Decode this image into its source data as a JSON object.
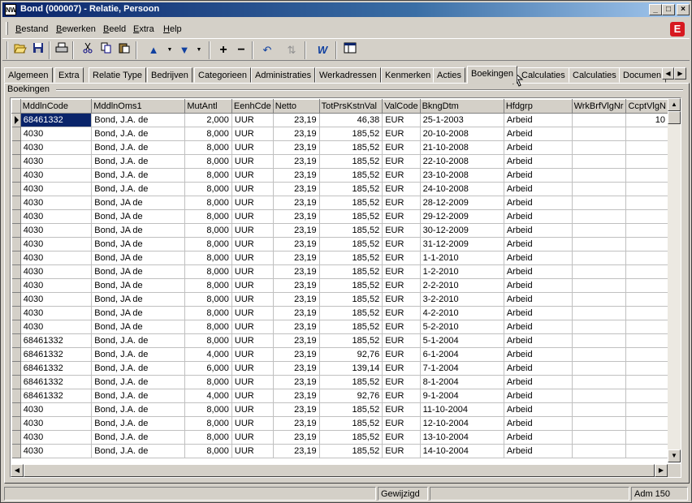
{
  "window": {
    "title": "Bond (000007) - Relatie, Persoon",
    "icon_label": "NW",
    "controls": [
      "_",
      "□",
      "×"
    ]
  },
  "menu": {
    "items": [
      "Bestand",
      "Bewerken",
      "Beeld",
      "Extra",
      "Help"
    ],
    "logo": "E"
  },
  "toolbar": {
    "icons": [
      "open-folder-icon",
      "save-icon",
      "print-icon",
      "cut-icon",
      "copy-icon",
      "paste-icon",
      "arrow-up-icon",
      "arrow-down-icon",
      "add-icon",
      "remove-icon",
      "undo-icon",
      "refresh-icon",
      "word-icon",
      "form-icon"
    ]
  },
  "tabs": {
    "items": [
      "Algemeen",
      "Extra",
      "Relatie Type",
      "Bedrijven",
      "Categorieen",
      "Administraties",
      "Werkadressen",
      "Kenmerken",
      "Acties",
      "Boekingen",
      "Calculaties",
      "Calculaties",
      "Documen"
    ],
    "active": "Boekingen"
  },
  "group": {
    "label": "Boekingen"
  },
  "grid": {
    "columns": [
      "MddlnCode",
      "MddlnOms1",
      "MutAntl",
      "EenhCde",
      "Netto",
      "TotPrsKstnVal",
      "ValCode",
      "BkngDtm",
      "Hfdgrp",
      "WrkBrfVlgNr",
      "CcptVlgN"
    ],
    "rows": [
      [
        "68461332",
        "Bond, J.A. de",
        "2,000",
        "UUR",
        "23,19",
        "46,38",
        "EUR",
        "25-1-2003",
        "Arbeid",
        "",
        "10"
      ],
      [
        "4030",
        "Bond, J.A. de",
        "8,000",
        "UUR",
        "23,19",
        "185,52",
        "EUR",
        "20-10-2008",
        "Arbeid",
        "",
        ""
      ],
      [
        "4030",
        "Bond, J.A. de",
        "8,000",
        "UUR",
        "23,19",
        "185,52",
        "EUR",
        "21-10-2008",
        "Arbeid",
        "",
        ""
      ],
      [
        "4030",
        "Bond, J.A. de",
        "8,000",
        "UUR",
        "23,19",
        "185,52",
        "EUR",
        "22-10-2008",
        "Arbeid",
        "",
        ""
      ],
      [
        "4030",
        "Bond, J.A. de",
        "8,000",
        "UUR",
        "23,19",
        "185,52",
        "EUR",
        "23-10-2008",
        "Arbeid",
        "",
        ""
      ],
      [
        "4030",
        "Bond, J.A. de",
        "8,000",
        "UUR",
        "23,19",
        "185,52",
        "EUR",
        "24-10-2008",
        "Arbeid",
        "",
        ""
      ],
      [
        "4030",
        "Bond, JA de",
        "8,000",
        "UUR",
        "23,19",
        "185,52",
        "EUR",
        "28-12-2009",
        "Arbeid",
        "",
        ""
      ],
      [
        "4030",
        "Bond, JA de",
        "8,000",
        "UUR",
        "23,19",
        "185,52",
        "EUR",
        "29-12-2009",
        "Arbeid",
        "",
        ""
      ],
      [
        "4030",
        "Bond, JA de",
        "8,000",
        "UUR",
        "23,19",
        "185,52",
        "EUR",
        "30-12-2009",
        "Arbeid",
        "",
        ""
      ],
      [
        "4030",
        "Bond, JA de",
        "8,000",
        "UUR",
        "23,19",
        "185,52",
        "EUR",
        "31-12-2009",
        "Arbeid",
        "",
        ""
      ],
      [
        "4030",
        "Bond, JA de",
        "8,000",
        "UUR",
        "23,19",
        "185,52",
        "EUR",
        "1-1-2010",
        "Arbeid",
        "",
        ""
      ],
      [
        "4030",
        "Bond, JA de",
        "8,000",
        "UUR",
        "23,19",
        "185,52",
        "EUR",
        "1-2-2010",
        "Arbeid",
        "",
        ""
      ],
      [
        "4030",
        "Bond, JA de",
        "8,000",
        "UUR",
        "23,19",
        "185,52",
        "EUR",
        "2-2-2010",
        "Arbeid",
        "",
        ""
      ],
      [
        "4030",
        "Bond, JA de",
        "8,000",
        "UUR",
        "23,19",
        "185,52",
        "EUR",
        "3-2-2010",
        "Arbeid",
        "",
        ""
      ],
      [
        "4030",
        "Bond, JA de",
        "8,000",
        "UUR",
        "23,19",
        "185,52",
        "EUR",
        "4-2-2010",
        "Arbeid",
        "",
        ""
      ],
      [
        "4030",
        "Bond, JA de",
        "8,000",
        "UUR",
        "23,19",
        "185,52",
        "EUR",
        "5-2-2010",
        "Arbeid",
        "",
        ""
      ],
      [
        "68461332",
        "Bond, J.A. de",
        "8,000",
        "UUR",
        "23,19",
        "185,52",
        "EUR",
        "5-1-2004",
        "Arbeid",
        "",
        ""
      ],
      [
        "68461332",
        "Bond, J.A. de",
        "4,000",
        "UUR",
        "23,19",
        "92,76",
        "EUR",
        "6-1-2004",
        "Arbeid",
        "",
        ""
      ],
      [
        "68461332",
        "Bond, J.A. de",
        "6,000",
        "UUR",
        "23,19",
        "139,14",
        "EUR",
        "7-1-2004",
        "Arbeid",
        "",
        ""
      ],
      [
        "68461332",
        "Bond, J.A. de",
        "8,000",
        "UUR",
        "23,19",
        "185,52",
        "EUR",
        "8-1-2004",
        "Arbeid",
        "",
        ""
      ],
      [
        "68461332",
        "Bond, J.A. de",
        "4,000",
        "UUR",
        "23,19",
        "92,76",
        "EUR",
        "9-1-2004",
        "Arbeid",
        "",
        ""
      ],
      [
        "4030",
        "Bond, J.A. de",
        "8,000",
        "UUR",
        "23,19",
        "185,52",
        "EUR",
        "11-10-2004",
        "Arbeid",
        "",
        ""
      ],
      [
        "4030",
        "Bond, J.A. de",
        "8,000",
        "UUR",
        "23,19",
        "185,52",
        "EUR",
        "12-10-2004",
        "Arbeid",
        "",
        ""
      ],
      [
        "4030",
        "Bond, J.A. de",
        "8,000",
        "UUR",
        "23,19",
        "185,52",
        "EUR",
        "13-10-2004",
        "Arbeid",
        "",
        ""
      ],
      [
        "4030",
        "Bond, J.A. de",
        "8,000",
        "UUR",
        "23,19",
        "185,52",
        "EUR",
        "14-10-2004",
        "Arbeid",
        "",
        ""
      ]
    ],
    "numeric_columns": [
      2,
      4,
      5,
      10
    ]
  },
  "status": {
    "cells": [
      "",
      "Gewijzigd",
      "",
      "Adm 150"
    ]
  }
}
